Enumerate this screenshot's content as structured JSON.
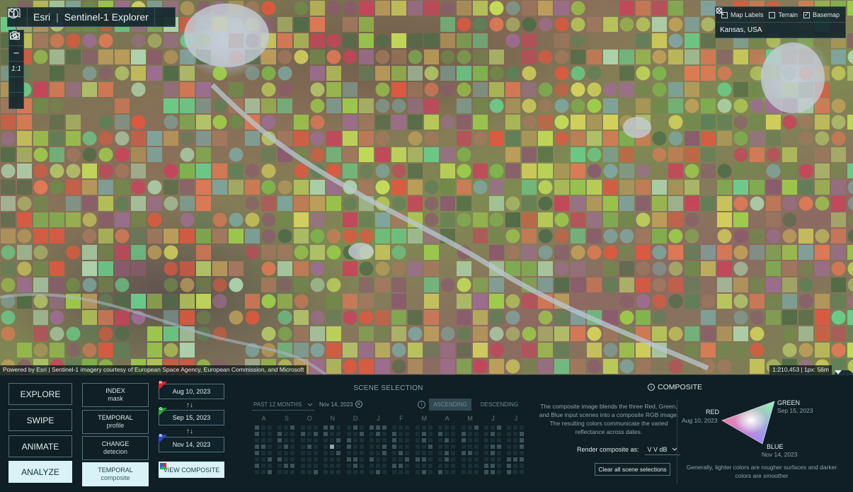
{
  "app": {
    "title": "Esri",
    "subtitle": "Sentinel-1 Explorer",
    "separator": "|"
  },
  "map_controls": {
    "zoom_in": "+",
    "zoom_out": "−",
    "scale_1to1": "1:1"
  },
  "layers": {
    "map_labels": {
      "label": "Map Labels",
      "checked": false
    },
    "terrain": {
      "label": "Terrain",
      "checked": false
    },
    "basemap": {
      "label": "Basemap",
      "checked": true
    }
  },
  "search": {
    "value": "Kansas, USA",
    "placeholder": ""
  },
  "attribution": "Powered by Esri | Sentinel-1 imagery courtesy of European Space Agency, European Commission, and Microsoft",
  "scale_info": "1:210,453 | 1px: 56m",
  "modes": [
    {
      "label": "EXPLORE",
      "active": false
    },
    {
      "label": "SWIPE",
      "active": false
    },
    {
      "label": "ANIMATE",
      "active": false
    },
    {
      "label": "ANALYZE",
      "active": true
    }
  ],
  "tools": [
    {
      "title": "INDEX",
      "sub": "mask",
      "active": false
    },
    {
      "title": "TEMPORAL",
      "sub": "profile",
      "active": false
    },
    {
      "title": "CHANGE",
      "sub": "detecion",
      "active": false
    },
    {
      "title": "TEMPORAL",
      "sub": "composite",
      "active": true
    }
  ],
  "composite_dates": [
    {
      "band": "R",
      "date": "Aug 10, 2023",
      "color": "#d8262e"
    },
    {
      "band": "G",
      "date": "Sep 15, 2023",
      "color": "#2f9e3b"
    },
    {
      "band": "B",
      "date": "Nov 14, 2023",
      "color": "#2a49c9"
    }
  ],
  "swap_symbol": "↑↓",
  "view_composite_label": "VIEW COMPOSITE",
  "scene_selection": {
    "header": "SCENE SELECTION",
    "range_label": "PAST 12 MONTHS",
    "selected_date": "Nov 14, 2023",
    "ascending_label": "ASCENDING",
    "descending_label": "DESCENDING",
    "months": [
      "A",
      "S",
      "O",
      "N",
      "D",
      "J",
      "F",
      "M",
      "A",
      "M",
      "J",
      "J"
    ]
  },
  "composite": {
    "header": "COMPOSITE",
    "description": "The composite image blends the three Red, Green, and Blue input scenes into a composite RGB image. The resulting colors communicate the varied reflectance across dates.",
    "render_label": "Render composite as:",
    "render_value": "V V dB",
    "clear_label": "Clear all scene selections",
    "red_label": "RED",
    "red_date": "Aug 10, 2023",
    "green_label": "GREEN",
    "green_date": "Sep 15, 2023",
    "blue_label": "BLUE",
    "blue_date": "Nov 14, 2023",
    "footer": "Generally, lighter colors are rougher surfaces and darker colors are smoother"
  }
}
